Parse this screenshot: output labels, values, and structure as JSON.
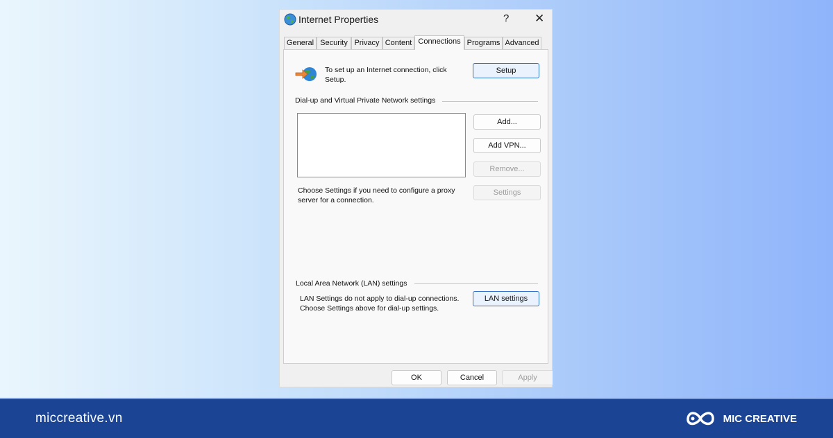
{
  "dialog": {
    "title": "Internet Properties",
    "help_glyph": "?",
    "close_glyph": "✕"
  },
  "tabs": [
    {
      "label": "General"
    },
    {
      "label": "Security"
    },
    {
      "label": "Privacy"
    },
    {
      "label": "Content"
    },
    {
      "label": "Connections",
      "active": true
    },
    {
      "label": "Programs"
    },
    {
      "label": "Advanced"
    }
  ],
  "setup": {
    "text": "To set up an Internet connection, click Setup.",
    "button": "Setup"
  },
  "dialup": {
    "heading": "Dial-up and Virtual Private Network settings",
    "add": "Add...",
    "add_vpn": "Add VPN...",
    "remove": "Remove...",
    "settings": "Settings",
    "proxy_text": "Choose Settings if you need to configure a proxy server for a connection."
  },
  "lan": {
    "heading": "Local Area Network (LAN) settings",
    "text": "LAN Settings do not apply to dial-up connections. Choose Settings above for dial-up settings.",
    "button": "LAN settings"
  },
  "footer_buttons": {
    "ok": "OK",
    "cancel": "Cancel",
    "apply": "Apply"
  },
  "banner": {
    "site": "miccreative.vn",
    "brand": "MIC CREATIVE"
  },
  "colors": {
    "footer_bg": "#1c4495",
    "focus_border": "#2f6fc9"
  }
}
